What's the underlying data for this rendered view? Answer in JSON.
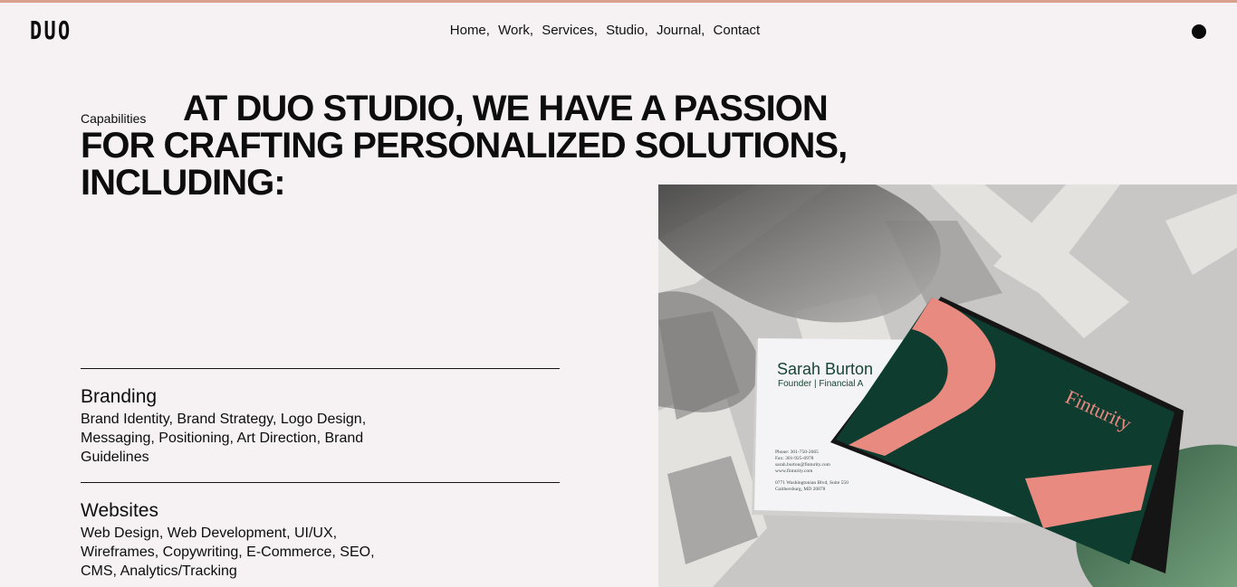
{
  "brand": {
    "logo": "DUO"
  },
  "nav": {
    "items": [
      {
        "label": "Home"
      },
      {
        "label": "Work"
      },
      {
        "label": "Services"
      },
      {
        "label": "Studio"
      },
      {
        "label": "Journal"
      },
      {
        "label": "Contact"
      }
    ],
    "separator": ","
  },
  "hero": {
    "eyebrow": "Capabilities",
    "headline": "AT DUO STUDIO, WE HAVE A PASSION FOR CRAFTING PERSONALIZED SOLUTIONS, INCLUDING:"
  },
  "capabilities": [
    {
      "title": "Branding",
      "description": "Brand Identity, Brand Strategy, Logo Design, Messaging, Positioning, Art Direction, Brand Guidelines"
    },
    {
      "title": "Websites",
      "description": "Web Design, Web Development, UI/UX, Wireframes, Copywriting, E-Commerce, SEO, CMS, Analytics/Tracking"
    }
  ],
  "image": {
    "card_name": "Sarah Burton",
    "card_role": "Founder | Financial A",
    "card_contact": [
      "Phone: 301-750-2665",
      "Fax: 301-925-6978",
      "sarah.burton@finturity.com",
      "www.finturity.com"
    ],
    "card_address": [
      "0771 Washingtonian Blvd, Suite 550",
      "Gaithersburg, MD 20878"
    ],
    "card_brand": "Finturity"
  },
  "colors": {
    "background": "#f6f2f4",
    "text": "#0d0d0d",
    "top_rule": "#d9a08e",
    "card_green": "#0e3d30",
    "card_pink": "#e98a80"
  }
}
